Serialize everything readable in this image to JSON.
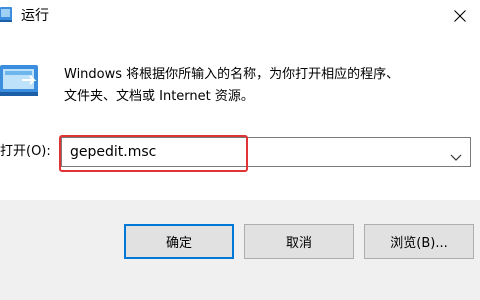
{
  "window": {
    "title": "运行",
    "title_icon": "run-app-icon",
    "close_icon": "close-icon"
  },
  "description": {
    "line1": "Windows 将根据你所输入的名称，为你打开相应的程序、",
    "line2": "文件夹、文档或 Internet 资源。"
  },
  "open_field": {
    "label": "打开(O):",
    "value": "gepedit.msc",
    "dropdown_icon": "chevron-down-icon"
  },
  "buttons": {
    "ok": "确定",
    "cancel": "取消",
    "browse": "浏览(B)..."
  },
  "colors": {
    "accent": "#0078d7",
    "highlight": "#e03434",
    "footer_bg": "#f0f0f0"
  }
}
